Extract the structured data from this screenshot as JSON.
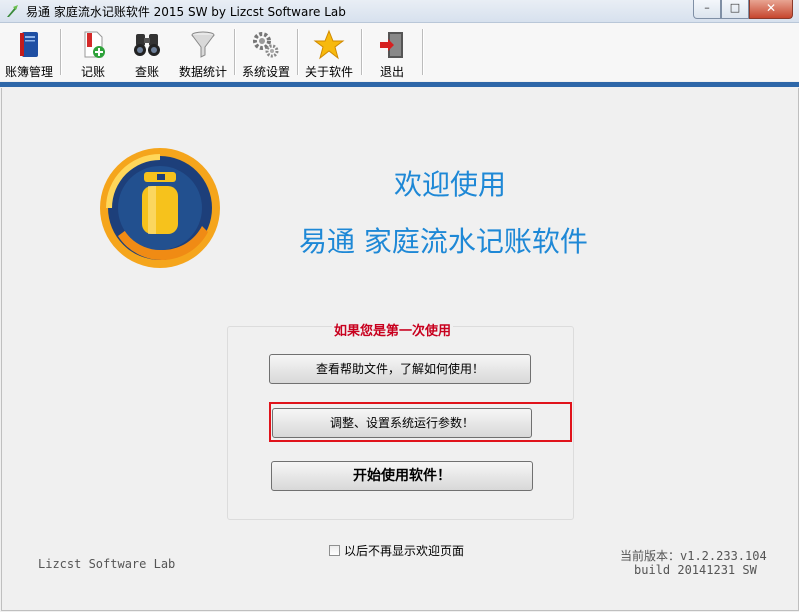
{
  "window": {
    "title": "易通 家庭流水记账软件 2015  SW   by Lizcst Software Lab",
    "minimize_label": "–",
    "maximize_label": "□",
    "close_label": "✕"
  },
  "toolbar": {
    "items": [
      {
        "label": "账簿管理",
        "icon": "ledger-book-icon"
      },
      {
        "label": "记账",
        "icon": "add-entry-icon"
      },
      {
        "label": "查账",
        "icon": "binoculars-icon"
      },
      {
        "label": "数据统计",
        "icon": "funnel-icon"
      },
      {
        "label": "系统设置",
        "icon": "gears-icon"
      },
      {
        "label": "关于软件",
        "icon": "star-icon"
      },
      {
        "label": "退出",
        "icon": "exit-door-icon"
      }
    ]
  },
  "welcome": {
    "heading": "欢迎使用",
    "app_name": "易通  家庭流水记账软件"
  },
  "first_use": {
    "title": "如果您是第一次使用",
    "help_button": "查看帮助文件，了解如何使用！",
    "settings_button": "调整、设置系统运行参数！",
    "start_button": "开始使用软件！"
  },
  "options": {
    "dont_show_again": "以后不再显示欢迎页面",
    "dont_show_again_checked": false
  },
  "footer": {
    "company": "Lizcst Software Lab",
    "version": "当前版本：v1.2.233.104",
    "build": "build 20141231  SW"
  },
  "colors": {
    "accent_blue": "#1e88d6",
    "title_red": "#c8001e",
    "highlight_red": "#e0131b",
    "toolbar_bar": "#2e67a8"
  }
}
